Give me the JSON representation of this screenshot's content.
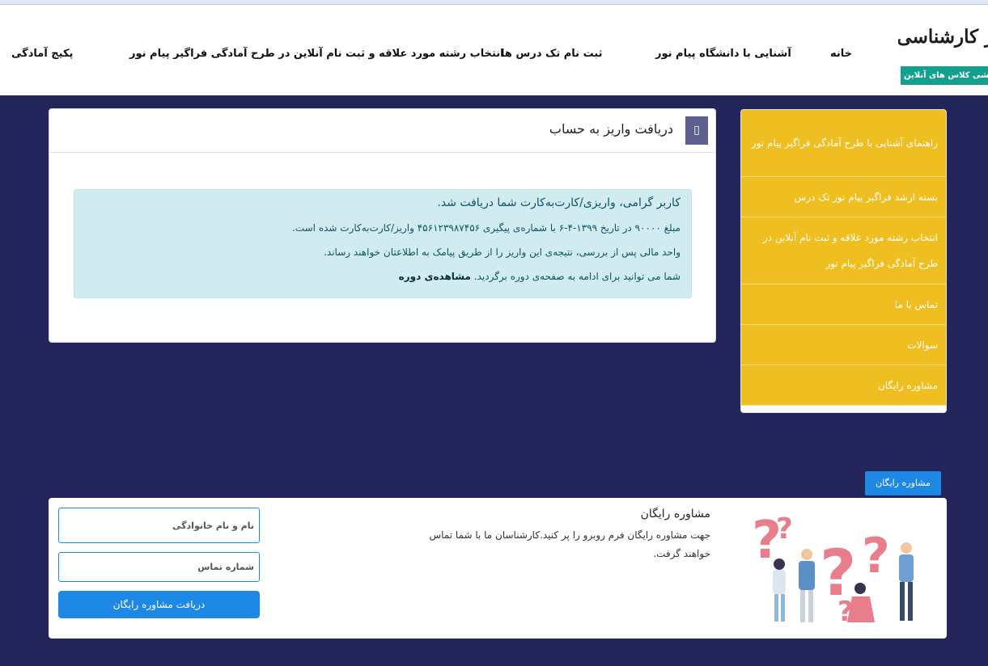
{
  "header": {
    "logo_title": "دفتر کارشناسی ارشد",
    "logo_strip": "آزمایشی کلاس های آنلاین",
    "nav": [
      {
        "label": "خانه"
      },
      {
        "label": "آشنایی با دانشگاه پیام نور"
      },
      {
        "label": "ثبت نام تک درس ها"
      },
      {
        "label": "انتخاب رشته مورد علاقه و ثبت نام آنلاین در طرح آمادگی فراگیر پیام نور"
      },
      {
        "label": "پکیج آمادگی"
      }
    ]
  },
  "main": {
    "card_title": "دریافت واریز به حساب",
    "alert": {
      "heading": "کاربر گرامی، واریزی/کارت‌به‌کارت شما دریافت شد.",
      "line1": "مبلغ ۹۰۰۰۰ در تاریخ ۱۳۹۹-۴-۶ با شماره‌ی پیگیری ۴۵۶۱۲۳۹۸۷۴۵۶ واریز/کارت‌به‌کارت شده است.",
      "line2": "واحد مالی پس از بررسی، نتیجه‌ی این واریز را از طریق پیامک به اطلاعتان خواهند رساند.",
      "line3": "شما می توانید برای ادامه به صفحه‌ی دوره برگردید.",
      "link": "مشاهده‌ی دوره"
    }
  },
  "sidebar": {
    "items": [
      {
        "label": "راهنمای آشنایی با طرح آمادگی فراگیر پیام نور"
      },
      {
        "label": "بسته ارشد فراگیر پیام نور تک درس"
      },
      {
        "label": "انتخاب رشته مورد علاقه و ثبت نام آنلاین در طرح آمادگی فراگیر پیام نور"
      },
      {
        "label": "تماس با ما"
      },
      {
        "label": "سوالات"
      },
      {
        "label": "مشاوره رایگان"
      }
    ]
  },
  "consult": {
    "tab_label": "مشاوره رایگان",
    "title": "مشاوره رایگان",
    "description": "جهت مشاوره رایگان فرم روبرو را پر کنید.کارشناسان ما با شما تماس خواهند گرفت.",
    "name_placeholder": "نام و نام خانوادگی",
    "phone_placeholder": "شماره تماس",
    "submit_label": "دریافت مشاوره رایگان"
  },
  "colors": {
    "background": "#23245a",
    "sidebar": "#efbe21",
    "primary": "#1e88e5",
    "alert_bg": "#d1ecf1"
  }
}
